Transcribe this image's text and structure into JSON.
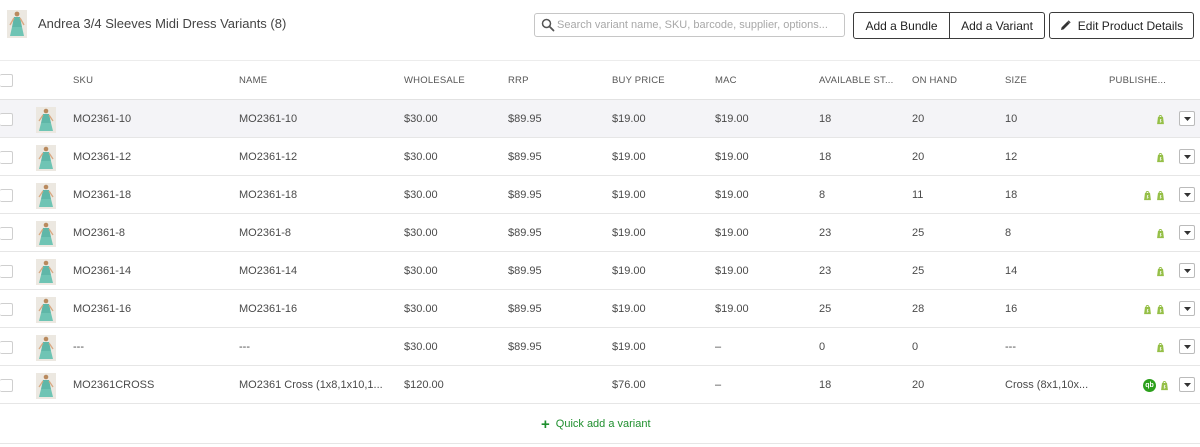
{
  "header": {
    "title": "Andrea 3/4 Sleeves Midi Dress Variants (8)",
    "search_placeholder": "Search variant name, SKU, barcode, supplier, options...",
    "buttons": {
      "add_bundle": "Add a Bundle",
      "add_variant": "Add a Variant",
      "edit_product": "Edit Product Details"
    }
  },
  "table": {
    "columns": {
      "sku": "SKU",
      "name": "NAME",
      "wholesale": "WHOLESALE",
      "rrp": "RRP",
      "buy_price": "BUY PRICE",
      "mac": "MAC",
      "available": "AVAILABLE ST...",
      "on_hand": "ON HAND",
      "size": "SIZE",
      "published": "PUBLISHE..."
    },
    "rows": [
      {
        "sku": "MO2361-10",
        "name": "MO2361-10",
        "wholesale": "$30.00",
        "rrp": "$89.95",
        "buy_price": "$19.00",
        "mac": "$19.00",
        "available": "18",
        "on_hand": "20",
        "size": "10",
        "channels": [
          "shopify-icon"
        ]
      },
      {
        "sku": "MO2361-12",
        "name": "MO2361-12",
        "wholesale": "$30.00",
        "rrp": "$89.95",
        "buy_price": "$19.00",
        "mac": "$19.00",
        "available": "18",
        "on_hand": "20",
        "size": "12",
        "channels": [
          "shopify-icon"
        ]
      },
      {
        "sku": "MO2361-18",
        "name": "MO2361-18",
        "wholesale": "$30.00",
        "rrp": "$89.95",
        "buy_price": "$19.00",
        "mac": "$19.00",
        "available": "8",
        "on_hand": "11",
        "size": "18",
        "channels": [
          "shopify-icon",
          "shopify-icon"
        ]
      },
      {
        "sku": "MO2361-8",
        "name": "MO2361-8",
        "wholesale": "$30.00",
        "rrp": "$89.95",
        "buy_price": "$19.00",
        "mac": "$19.00",
        "available": "23",
        "on_hand": "25",
        "size": "8",
        "channels": [
          "shopify-icon"
        ]
      },
      {
        "sku": "MO2361-14",
        "name": "MO2361-14",
        "wholesale": "$30.00",
        "rrp": "$89.95",
        "buy_price": "$19.00",
        "mac": "$19.00",
        "available": "23",
        "on_hand": "25",
        "size": "14",
        "channels": [
          "shopify-icon"
        ]
      },
      {
        "sku": "MO2361-16",
        "name": "MO2361-16",
        "wholesale": "$30.00",
        "rrp": "$89.95",
        "buy_price": "$19.00",
        "mac": "$19.00",
        "available": "25",
        "on_hand": "28",
        "size": "16",
        "channels": [
          "shopify-icon",
          "shopify-icon"
        ]
      },
      {
        "sku": "---",
        "name": "---",
        "wholesale": "$30.00",
        "rrp": "$89.95",
        "buy_price": "$19.00",
        "mac": "–",
        "available": "0",
        "on_hand": "0",
        "size": "---",
        "channels": [
          "shopify-icon"
        ]
      },
      {
        "sku": "MO2361CROSS",
        "name": "MO2361 Cross (1x8,1x10,1...",
        "wholesale": "$120.00",
        "rrp": "",
        "buy_price": "$76.00",
        "mac": "–",
        "available": "18",
        "on_hand": "20",
        "size": "Cross (8x1,10x...",
        "channels": [
          "quickbooks-icon",
          "shopify-icon"
        ]
      }
    ]
  },
  "quick_add": {
    "label": "Quick add a variant"
  },
  "colors": {
    "accent_green": "#1f8f2e",
    "shopify_green": "#95bf47",
    "quickbooks_green": "#2ca01c",
    "row_highlight": "#f4f4f7"
  },
  "icons": {
    "qb_text": "qb"
  }
}
